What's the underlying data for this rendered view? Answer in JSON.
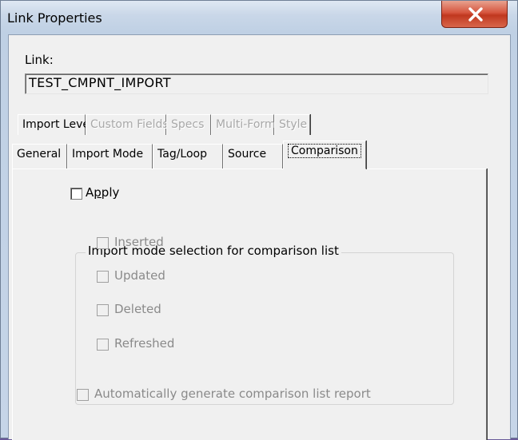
{
  "window": {
    "title": "Link Properties",
    "close_icon": "close-icon"
  },
  "link": {
    "label": "Link:",
    "value": "TEST_CMPNT_IMPORT"
  },
  "tabs_row1": [
    {
      "label": "Import Level",
      "enabled": true
    },
    {
      "label": "Custom Fields",
      "enabled": false
    },
    {
      "label": "Specs",
      "enabled": false
    },
    {
      "label": "Multi-Form",
      "enabled": false
    },
    {
      "label": "Style",
      "enabled": false
    }
  ],
  "tabs_row2": [
    {
      "label": "General"
    },
    {
      "label": "Import Mode"
    },
    {
      "label": "Tag/Loop"
    },
    {
      "label": "Source"
    },
    {
      "label": "Comparison",
      "active": true
    }
  ],
  "comparison": {
    "apply": {
      "label_pre": "A",
      "label_mnemonic": "p",
      "label_post": "ply",
      "checked": false
    },
    "group_title": "Import mode selection for comparison list",
    "options": [
      {
        "label": "Inserted",
        "checked": false,
        "enabled": false
      },
      {
        "label": "Updated",
        "checked": false,
        "enabled": false
      },
      {
        "label": "Deleted",
        "checked": false,
        "enabled": false
      },
      {
        "label": "Refreshed",
        "checked": false,
        "enabled": false
      }
    ],
    "auto_report": {
      "label": "Automatically generate comparison list report",
      "checked": false,
      "enabled": false
    }
  }
}
